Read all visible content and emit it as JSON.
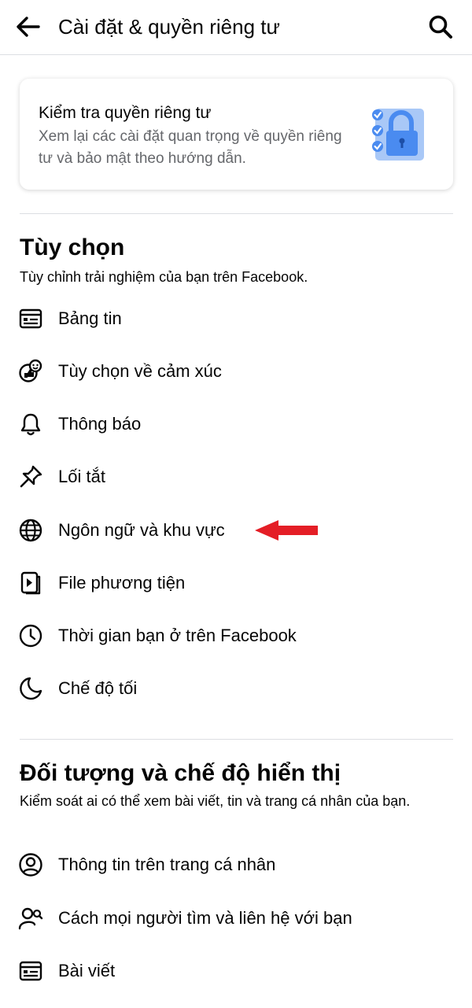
{
  "header": {
    "title": "Cài đặt & quyền riêng tư",
    "back_icon": "arrow-left-icon",
    "search_icon": "search-icon"
  },
  "privacy_card": {
    "title": "Kiểm tra quyền riêng tư",
    "description": "Xem lại các cài đặt quan trọng về quyền riêng tư và bảo mật theo hướng dẫn.",
    "illustration": "padlock-checklist-icon"
  },
  "preferences": {
    "title": "Tùy chọn",
    "description": "Tùy chỉnh trải nghiệm của bạn trên Facebook.",
    "items": [
      {
        "label": "Bảng tin",
        "icon": "news-feed-icon"
      },
      {
        "label": "Tùy chọn về cảm xúc",
        "icon": "reactions-icon"
      },
      {
        "label": "Thông báo",
        "icon": "bell-icon"
      },
      {
        "label": "Lối tắt",
        "icon": "pin-icon"
      },
      {
        "label": "Ngôn ngữ và khu vực",
        "icon": "globe-icon"
      },
      {
        "label": "File phương tiện",
        "icon": "media-icon"
      },
      {
        "label": "Thời gian bạn ở trên Facebook",
        "icon": "clock-icon"
      },
      {
        "label": "Chế độ tối",
        "icon": "moon-icon"
      }
    ]
  },
  "audience": {
    "title": "Đối tượng và chế độ hiển thị",
    "description": "Kiểm soát ai có thể xem bài viết, tin và trang cá nhân của bạn.",
    "items": [
      {
        "label": "Thông tin trên trang cá nhân",
        "icon": "profile-circle-icon"
      },
      {
        "label": "Cách mọi người tìm và liên hệ với bạn",
        "icon": "person-search-icon"
      },
      {
        "label": "Bài viết",
        "icon": "posts-icon"
      }
    ]
  },
  "annotation": {
    "arrow_icon": "red-arrow-icon",
    "color": "#e41e26"
  },
  "colors": {
    "text_primary": "#050505",
    "text_secondary": "#65676b",
    "divider": "#dcdee2",
    "illustration_blue": "#4a8bf0"
  }
}
